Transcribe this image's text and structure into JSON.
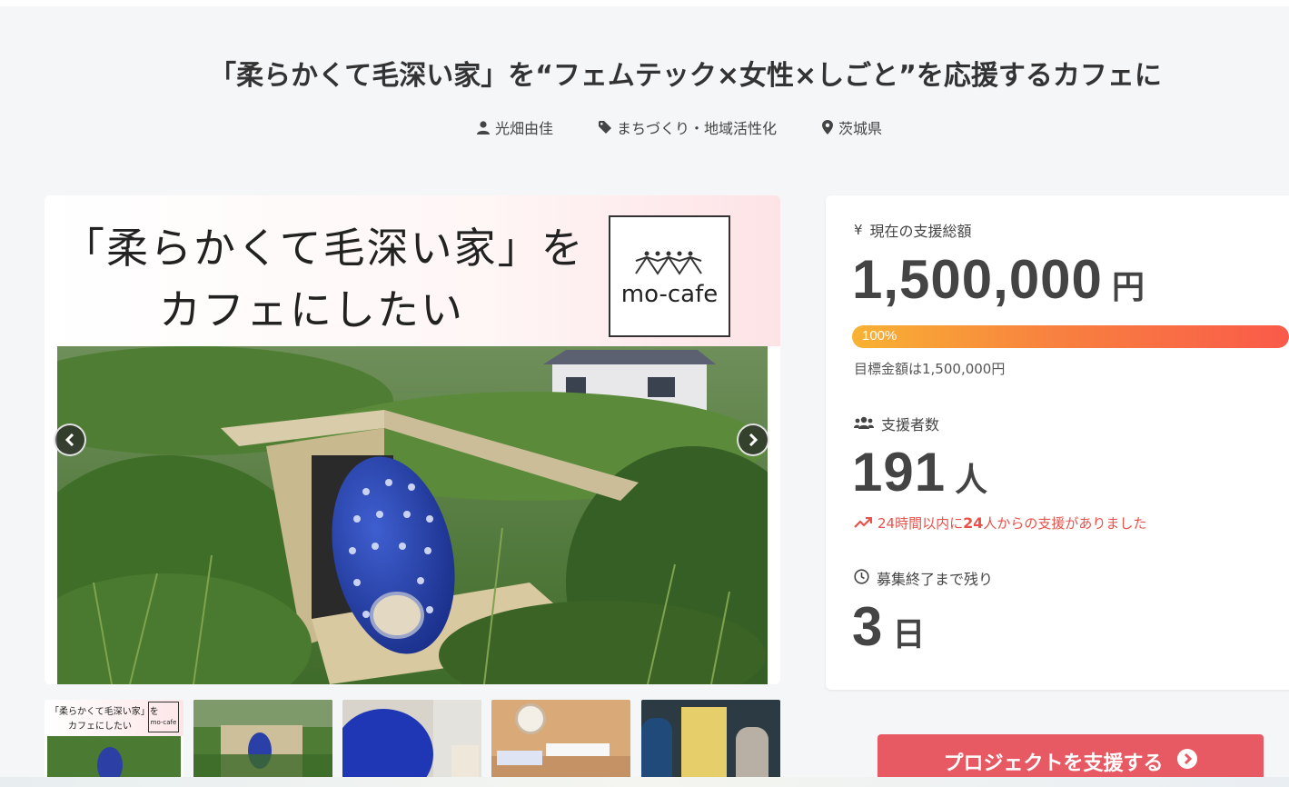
{
  "project": {
    "title": "「柔らかくて毛深い家」を“フェムテック×女性×しごと”を応援するカフェに",
    "owner": "光畑由佳",
    "category": "まちづくり・地域活性化",
    "location": "茨城県"
  },
  "hero": {
    "line1": "「柔らかくて毛深い家」を",
    "line2": "カフェにしたい",
    "logo_text": "mo-cafe"
  },
  "thumbnails": [
    {
      "caption_line1": "「柔らかくて毛深い家」を",
      "caption_line2": "カフェにしたい",
      "logo": "mo-cafe"
    },
    {
      "caption_line1": "",
      "caption_line2": "",
      "logo": ""
    },
    {
      "caption_line1": "",
      "caption_line2": "",
      "logo": ""
    },
    {
      "caption_line1": "",
      "caption_line2": "",
      "logo": ""
    },
    {
      "caption_line1": "",
      "caption_line2": "",
      "logo": ""
    }
  ],
  "stats": {
    "total_label": "現在の支援総額",
    "total_value": "1,500,000",
    "total_unit": "円",
    "progress_percent": 100,
    "progress_label": "100%",
    "goal_text": "目標金額は1,500,000円",
    "backers_label": "支援者数",
    "backers_value": "191",
    "backers_unit": "人",
    "recent_prefix": "24時間以内に",
    "recent_count": "24",
    "recent_suffix": "人からの支援がありました",
    "remaining_label": "募集終了まで残り",
    "remaining_value": "3",
    "remaining_unit": "日"
  },
  "actions": {
    "support_button": "プロジェクトを支援する"
  },
  "colors": {
    "accent_red": "#e85a63",
    "progress_start": "#f8b233",
    "progress_end": "#fa5a4a",
    "recent_text": "#e9524a"
  },
  "icons": {
    "owner": "user-icon",
    "category": "tag-icon",
    "location": "map-pin-icon",
    "total": "yen-icon",
    "backers": "users-icon",
    "recent": "trending-up-icon",
    "remaining": "clock-icon",
    "support": "arrow-circle-right-icon"
  }
}
